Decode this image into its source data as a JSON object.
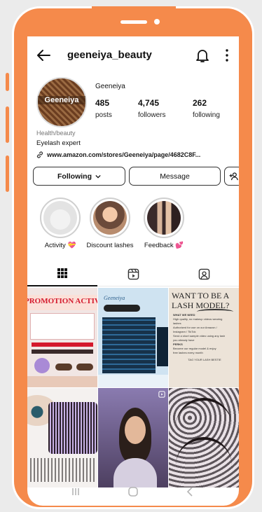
{
  "profile": {
    "username": "geeneiya_beauty",
    "display_name": "Geeneiya",
    "avatar_text": "Geeneiya",
    "category": "Health/beauty",
    "bio": "Eyelash expert",
    "link": "www.amazon.com/stores/Geeneiya/page/4682C8F..."
  },
  "stats": [
    {
      "value": "485",
      "label": "posts"
    },
    {
      "value": "4,745",
      "label": "followers"
    },
    {
      "value": "262",
      "label": "following"
    }
  ],
  "buttons": {
    "following": "Following",
    "message": "Message"
  },
  "highlights": [
    {
      "label": "Activity 💝"
    },
    {
      "label": "Discount lashes"
    },
    {
      "label": "Feedback 💕"
    }
  ],
  "tabs": [
    {
      "icon": "grid-icon",
      "active": true
    },
    {
      "icon": "reels-icon",
      "active": false
    },
    {
      "icon": "tagged-icon",
      "active": false
    }
  ],
  "posts": [
    {
      "caption": "PROMOTION ACTIVIT"
    },
    {
      "caption": "Geeneiya"
    },
    {
      "caption": "WANT TO BE A LASH MODEL?"
    },
    {
      "caption": ""
    },
    {
      "caption": ""
    },
    {
      "caption": ""
    }
  ],
  "post3_lines": [
    "WHAT WE NEED",
    "High quality, no makeup videos wearing",
    "lashes",
    "Authorized for use on our Amazon /",
    "Instagram / TikTok",
    "Send a short sample video using any lash",
    "you already have",
    "PERKS",
    "Become our regular model & enjoy",
    "free lashes every month",
    "TAG YOUR LASH BESTIE"
  ],
  "colors": {
    "frame": "#f58a4b",
    "background": "#ebebeb",
    "screen": "#ffffff"
  }
}
